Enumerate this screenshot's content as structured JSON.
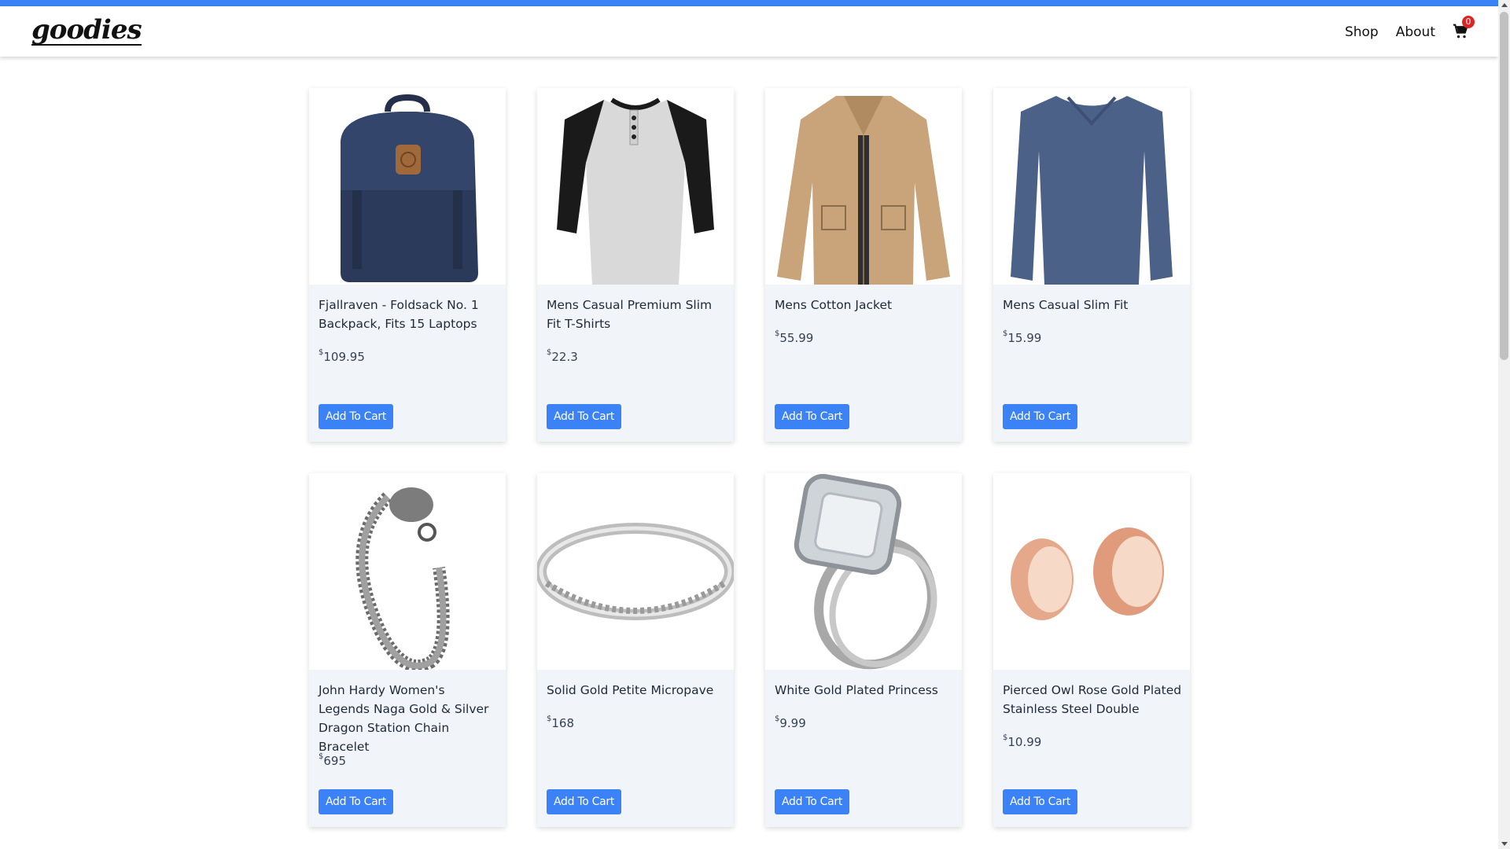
{
  "brand": {
    "logo": "goodies",
    "accent": "#3b82f6"
  },
  "nav": {
    "shop_label": "Shop",
    "about_label": "About",
    "cart_icon": "cart-icon",
    "cart_count": "0"
  },
  "products": [
    {
      "title": "Fjallraven - Foldsack No. 1 Backpack, Fits 15 Laptops",
      "currency": "$",
      "price": "109.95",
      "button": "Add To Cart",
      "image": "backpack"
    },
    {
      "title": "Mens Casual Premium Slim Fit T-Shirts",
      "currency": "$",
      "price": "22.3",
      "button": "Add To Cart",
      "image": "raglan-tshirt"
    },
    {
      "title": "Mens Cotton Jacket",
      "currency": "$",
      "price": "55.99",
      "button": "Add To Cart",
      "image": "jacket"
    },
    {
      "title": "Mens Casual Slim Fit",
      "currency": "$",
      "price": "15.99",
      "button": "Add To Cart",
      "image": "long-sleeve-shirt"
    },
    {
      "title": "John Hardy Women's Legends Naga Gold & Silver Dragon Station Chain Bracelet",
      "currency": "$",
      "price": "695",
      "button": "Add To Cart",
      "image": "bracelet"
    },
    {
      "title": "Solid Gold Petite Micropave",
      "currency": "$",
      "price": "168",
      "button": "Add To Cart",
      "image": "ring"
    },
    {
      "title": "White Gold Plated Princess",
      "currency": "$",
      "price": "9.99",
      "button": "Add To Cart",
      "image": "diamond-ring"
    },
    {
      "title": "Pierced Owl Rose Gold Plated Stainless Steel Double",
      "currency": "$",
      "price": "10.99",
      "button": "Add To Cart",
      "image": "rose-gold-tunnels"
    }
  ]
}
